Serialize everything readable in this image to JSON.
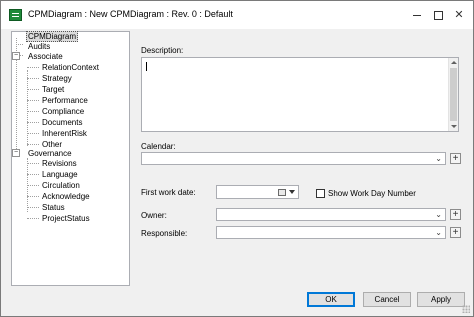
{
  "window": {
    "title": "CPMDiagram : New CPMDiagram : Rev. 0  : Default",
    "close_glyph": "✕"
  },
  "tree": {
    "root": "CPMDiagram",
    "audits": "Audits",
    "associate": {
      "label": "Associate",
      "expander": "−",
      "children": [
        "RelationContext",
        "Strategy",
        "Target",
        "Performance",
        "Compliance",
        "Documents",
        "InherentRisk",
        "Other"
      ]
    },
    "governance": {
      "label": "Governance",
      "expander": "−",
      "children": [
        "Revisions",
        "Language",
        "Circulation",
        "Acknowledge",
        "Status",
        "ProjectStatus"
      ]
    }
  },
  "form": {
    "description_label": "Description:",
    "description_value": "",
    "calendar_label": "Calendar:",
    "calendar_value": "",
    "first_work_date_label": "First work date:",
    "first_work_date_value": "",
    "show_work_day_label": "Show Work Day Number",
    "show_work_day_checked": false,
    "owner_label": "Owner:",
    "owner_value": "",
    "responsible_label": "Responsible:",
    "responsible_value": "",
    "combo_arrow": "⌄",
    "plus_glyph": "+"
  },
  "buttons": {
    "ok": "OK",
    "cancel": "Cancel",
    "apply": "Apply"
  },
  "icons": {
    "app": "cpm-app-icon",
    "calendar": "calendar-icon"
  },
  "colors": {
    "app_icon": "#1f8a3a",
    "default_button_border": "#0078d7"
  }
}
